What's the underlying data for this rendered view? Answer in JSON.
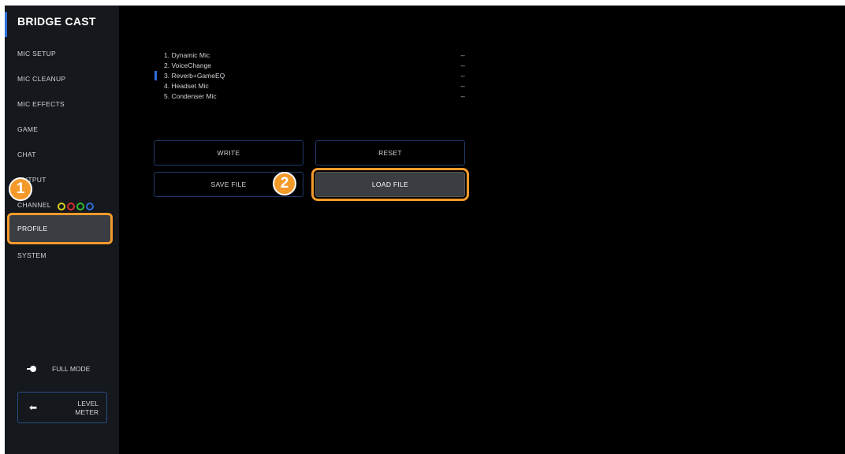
{
  "app": {
    "title": "BRIDGE CAST"
  },
  "sidebar": {
    "items": [
      {
        "label": "MIC SETUP"
      },
      {
        "label": "MIC CLEANUP"
      },
      {
        "label": "MIC EFFECTS"
      },
      {
        "label": "GAME"
      },
      {
        "label": "CHAT"
      },
      {
        "label": "OUTPUT"
      },
      {
        "label": "CHANNEL"
      },
      {
        "label": "PROFILE",
        "active": true
      },
      {
        "label": "SYSTEM"
      }
    ],
    "channel_ring_colors": [
      "#d8d020",
      "#d83030",
      "#30c030",
      "#2e6fd8"
    ],
    "mode_label": "FULL MODE",
    "level_meter_label": "LEVEL\nMETER"
  },
  "profiles": {
    "items": [
      {
        "name": "1. Dynamic Mic",
        "value": "--"
      },
      {
        "name": "2. VoiceChange",
        "value": "--"
      },
      {
        "name": "3. Reverb+GameEQ",
        "value": "--",
        "selected": true
      },
      {
        "name": "4. Headset Mic",
        "value": "--"
      },
      {
        "name": "5. Condenser Mic",
        "value": "--"
      }
    ]
  },
  "buttons": {
    "write": "WRITE",
    "reset": "RESET",
    "save_file": "SAVE FILE",
    "load_file": "LOAD FILE"
  },
  "markers": {
    "one": "1",
    "two": "2"
  },
  "colors": {
    "accent": "#2e6fd8",
    "highlight": "#f39a2b"
  }
}
